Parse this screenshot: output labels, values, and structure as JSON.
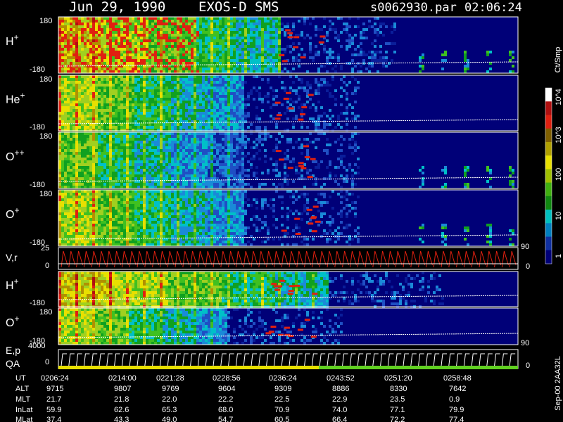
{
  "header": {
    "date": "Jun 29, 1990",
    "instrument": "EXOS-D SMS",
    "file": "s0062930.par",
    "time": "02:06:24"
  },
  "colorbar": {
    "label": "Ct/Smp",
    "ticks": [
      "10^4",
      "10^3",
      "100",
      "10",
      "1"
    ],
    "tick_values": [
      10000,
      1000,
      100,
      10,
      1
    ],
    "colors": [
      "#ffffff",
      "#b01010",
      "#e02010",
      "#806000",
      "#b0a000",
      "#e8e000",
      "#a0c000",
      "#40b010",
      "#108810",
      "#00c0c0",
      "#0080c0",
      "#1030a0",
      "#000078"
    ]
  },
  "panels": [
    {
      "id": "H+ upper",
      "label": "H",
      "charge": "+",
      "ylim": [
        -180,
        180
      ],
      "tick_top": "180",
      "tick_bottom": "-180",
      "decay": 0.48,
      "base": 6,
      "blobs": true
    },
    {
      "id": "He+",
      "label": "He",
      "charge": "+",
      "ylim": [
        -180,
        180
      ],
      "tick_top": "180",
      "tick_bottom": "-180",
      "decay": 0.4,
      "base": 5,
      "blobs": false
    },
    {
      "id": "O++",
      "label": "O",
      "charge": "++",
      "ylim": [
        -180,
        180
      ],
      "tick_top": "180",
      "tick_bottom": "-180",
      "decay": 0.4,
      "base": 4,
      "blobs": true
    },
    {
      "id": "O+ upper",
      "label": "O",
      "charge": "+",
      "ylim": [
        -180,
        180
      ],
      "tick_top": "180",
      "tick_bottom": "-180",
      "decay": 0.4,
      "base": 5,
      "blobs": true
    },
    {
      "id": "H+ lower",
      "label": "H",
      "charge": "+",
      "ylim": [
        -180,
        180
      ],
      "tick_top": "",
      "tick_bottom": "-180",
      "decay": 0.58,
      "base": 6,
      "blobs": false
    },
    {
      "id": "O+ lower",
      "label": "O",
      "charge": "+",
      "ylim": [
        -180,
        180
      ],
      "tick_top": "180",
      "tick_bottom": "-180",
      "decay": 0.36,
      "base": 5,
      "blobs": false
    }
  ],
  "vr_panel": {
    "label": "V,r",
    "left_ticks": [
      "25",
      "0"
    ],
    "right_ticks": [
      "90",
      "0"
    ]
  },
  "ep_panel": {
    "label1": "E,p",
    "label2": "QA",
    "left_ticks": [
      "4000",
      "0"
    ],
    "right_ticks": [
      "90",
      "0"
    ]
  },
  "right_side_ticks": {
    "lower_h_panel": "90"
  },
  "side_note": "Sep-00 2AA32L",
  "table": {
    "row_labels": [
      "UT",
      "ALT",
      "MLT",
      "InLat",
      "MLat"
    ],
    "columns": [
      {
        "UT": "0206:24",
        "ALT": "9715",
        "MLT": "21.7",
        "InLat": "59.9",
        "MLat": "37.4"
      },
      {
        "UT": "0214:00",
        "ALT": "9807",
        "MLT": "21.8",
        "InLat": "62.6",
        "MLat": "43.3"
      },
      {
        "UT": "0221:28",
        "ALT": "9769",
        "MLT": "22.0",
        "InLat": "65.3",
        "MLat": "49.0"
      },
      {
        "UT": "0228:56",
        "ALT": "9604",
        "MLT": "22.2",
        "InLat": "68.0",
        "MLat": "54.7"
      },
      {
        "UT": "0236:24",
        "ALT": "9309",
        "MLT": "22.5",
        "InLat": "70.9",
        "MLat": "60.5"
      },
      {
        "UT": "0243:52",
        "ALT": "8886",
        "MLT": "22.9",
        "InLat": "74.0",
        "MLat": "66.4"
      },
      {
        "UT": "0251:20",
        "ALT": "8330",
        "MLT": "23.5",
        "InLat": "77.1",
        "MLat": "72.2"
      },
      {
        "UT": "0258:48",
        "ALT": "7642",
        "MLT": "0.9",
        "InLat": "79.9",
        "MLat": "77.4"
      }
    ]
  },
  "chart_data": {
    "type": "heatmap",
    "title": "Jun 29, 1990   EXOS-D SMS",
    "x_ticks": [
      "0206:24",
      "0214:00",
      "0221:28",
      "0228:56",
      "0236:24",
      "0243:52",
      "0251:20",
      "0258:48"
    ],
    "ylim": [
      -180,
      180
    ],
    "colorbar_label": "Ct/Smp",
    "colorbar_range": [
      1,
      10000
    ],
    "scale": "log",
    "series": [
      {
        "name": "H+"
      },
      {
        "name": "He+"
      },
      {
        "name": "O++"
      },
      {
        "name": "O+"
      },
      {
        "name": "V,r"
      },
      {
        "name": "H+"
      },
      {
        "name": "O+"
      },
      {
        "name": "E,p"
      },
      {
        "name": "QA"
      }
    ]
  }
}
